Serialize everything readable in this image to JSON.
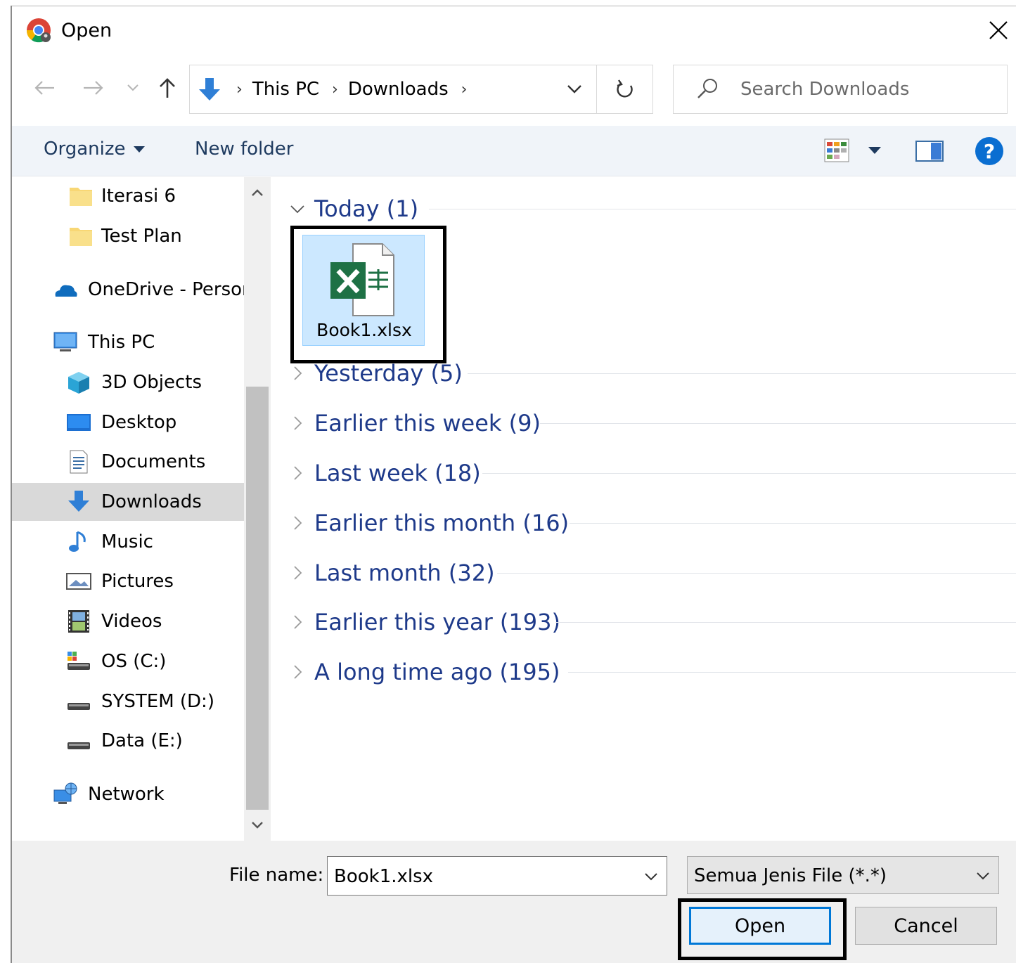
{
  "window": {
    "title": "Open",
    "close_icon": "close-icon"
  },
  "nav": {
    "back_icon": "back-arrow-icon",
    "forward_icon": "forward-arrow-icon",
    "recent_icon": "chevron-down-icon",
    "up_icon": "up-arrow-icon"
  },
  "address": {
    "segments": [
      "This PC",
      "Downloads"
    ],
    "separator": "›",
    "refresh_icon": "refresh-icon"
  },
  "search": {
    "placeholder": "Search Downloads"
  },
  "toolbar": {
    "organize_label": "Organize",
    "new_folder_label": "New folder",
    "help_label": "?"
  },
  "sidebar": {
    "items": [
      {
        "label": "Iterasi 6",
        "icon": "folder-icon"
      },
      {
        "label": "Test Plan",
        "icon": "folder-icon"
      },
      {
        "label": "OneDrive - Persor",
        "icon": "cloud-icon"
      },
      {
        "label": "This PC",
        "icon": "computer-icon"
      },
      {
        "label": "3D Objects",
        "icon": "cube-icon"
      },
      {
        "label": "Desktop",
        "icon": "desktop-icon"
      },
      {
        "label": "Documents",
        "icon": "document-icon"
      },
      {
        "label": "Downloads",
        "icon": "download-icon",
        "selected": true
      },
      {
        "label": "Music",
        "icon": "music-icon"
      },
      {
        "label": "Pictures",
        "icon": "picture-icon"
      },
      {
        "label": "Videos",
        "icon": "video-icon"
      },
      {
        "label": "OS (C:)",
        "icon": "drive-icon"
      },
      {
        "label": "SYSTEM (D:)",
        "icon": "drive-icon"
      },
      {
        "label": "Data (E:)",
        "icon": "drive-icon"
      },
      {
        "label": "Network",
        "icon": "network-icon"
      }
    ]
  },
  "content": {
    "groups": [
      {
        "label": "Today (1)",
        "expanded": true
      },
      {
        "label": "Yesterday (5)",
        "expanded": false
      },
      {
        "label": "Earlier this week (9)",
        "expanded": false
      },
      {
        "label": "Last week (18)",
        "expanded": false
      },
      {
        "label": "Earlier this month (16)",
        "expanded": false
      },
      {
        "label": "Last month (32)",
        "expanded": false
      },
      {
        "label": "Earlier this year (193)",
        "expanded": false
      },
      {
        "label": "A long time ago (195)",
        "expanded": false
      }
    ],
    "files": [
      {
        "name": "Book1.xlsx",
        "icon": "excel-file-icon",
        "selected": true
      }
    ]
  },
  "footer": {
    "file_name_label": "File name:",
    "file_name_value": "Book1.xlsx",
    "file_type_value": "Semua Jenis File (*.*)",
    "open_label": "Open",
    "cancel_label": "Cancel"
  },
  "colors": {
    "accent": "#0078d7",
    "group_text": "#1e3a8a",
    "selection": "#cce8ff",
    "footer_bg": "#f0f0f0"
  }
}
